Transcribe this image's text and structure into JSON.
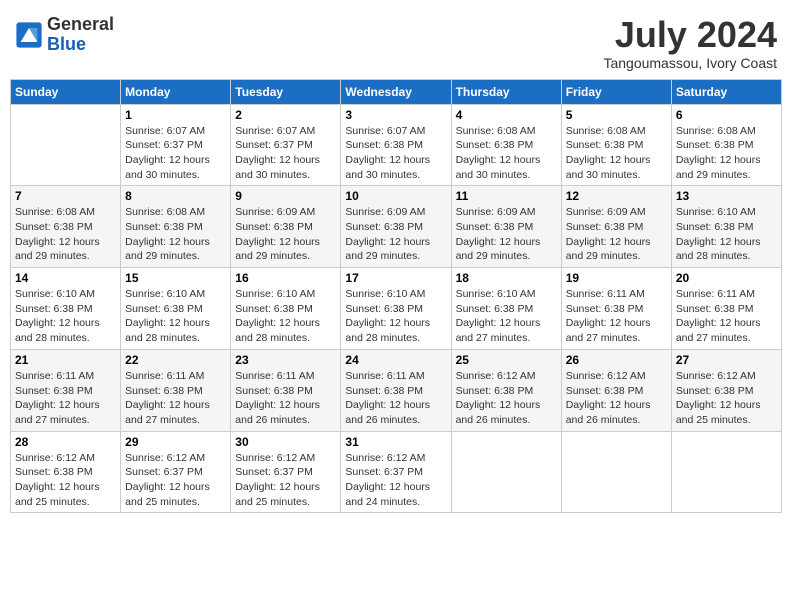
{
  "header": {
    "logo_line1": "General",
    "logo_line2": "Blue",
    "month_year": "July 2024",
    "location": "Tangoumassou, Ivory Coast"
  },
  "days_of_week": [
    "Sunday",
    "Monday",
    "Tuesday",
    "Wednesday",
    "Thursday",
    "Friday",
    "Saturday"
  ],
  "weeks": [
    [
      {
        "day": "",
        "info": ""
      },
      {
        "day": "1",
        "info": "Sunrise: 6:07 AM\nSunset: 6:37 PM\nDaylight: 12 hours\nand 30 minutes."
      },
      {
        "day": "2",
        "info": "Sunrise: 6:07 AM\nSunset: 6:37 PM\nDaylight: 12 hours\nand 30 minutes."
      },
      {
        "day": "3",
        "info": "Sunrise: 6:07 AM\nSunset: 6:38 PM\nDaylight: 12 hours\nand 30 minutes."
      },
      {
        "day": "4",
        "info": "Sunrise: 6:08 AM\nSunset: 6:38 PM\nDaylight: 12 hours\nand 30 minutes."
      },
      {
        "day": "5",
        "info": "Sunrise: 6:08 AM\nSunset: 6:38 PM\nDaylight: 12 hours\nand 30 minutes."
      },
      {
        "day": "6",
        "info": "Sunrise: 6:08 AM\nSunset: 6:38 PM\nDaylight: 12 hours\nand 29 minutes."
      }
    ],
    [
      {
        "day": "7",
        "info": "Sunrise: 6:08 AM\nSunset: 6:38 PM\nDaylight: 12 hours\nand 29 minutes."
      },
      {
        "day": "8",
        "info": "Sunrise: 6:08 AM\nSunset: 6:38 PM\nDaylight: 12 hours\nand 29 minutes."
      },
      {
        "day": "9",
        "info": "Sunrise: 6:09 AM\nSunset: 6:38 PM\nDaylight: 12 hours\nand 29 minutes."
      },
      {
        "day": "10",
        "info": "Sunrise: 6:09 AM\nSunset: 6:38 PM\nDaylight: 12 hours\nand 29 minutes."
      },
      {
        "day": "11",
        "info": "Sunrise: 6:09 AM\nSunset: 6:38 PM\nDaylight: 12 hours\nand 29 minutes."
      },
      {
        "day": "12",
        "info": "Sunrise: 6:09 AM\nSunset: 6:38 PM\nDaylight: 12 hours\nand 29 minutes."
      },
      {
        "day": "13",
        "info": "Sunrise: 6:10 AM\nSunset: 6:38 PM\nDaylight: 12 hours\nand 28 minutes."
      }
    ],
    [
      {
        "day": "14",
        "info": "Sunrise: 6:10 AM\nSunset: 6:38 PM\nDaylight: 12 hours\nand 28 minutes."
      },
      {
        "day": "15",
        "info": "Sunrise: 6:10 AM\nSunset: 6:38 PM\nDaylight: 12 hours\nand 28 minutes."
      },
      {
        "day": "16",
        "info": "Sunrise: 6:10 AM\nSunset: 6:38 PM\nDaylight: 12 hours\nand 28 minutes."
      },
      {
        "day": "17",
        "info": "Sunrise: 6:10 AM\nSunset: 6:38 PM\nDaylight: 12 hours\nand 28 minutes."
      },
      {
        "day": "18",
        "info": "Sunrise: 6:10 AM\nSunset: 6:38 PM\nDaylight: 12 hours\nand 27 minutes."
      },
      {
        "day": "19",
        "info": "Sunrise: 6:11 AM\nSunset: 6:38 PM\nDaylight: 12 hours\nand 27 minutes."
      },
      {
        "day": "20",
        "info": "Sunrise: 6:11 AM\nSunset: 6:38 PM\nDaylight: 12 hours\nand 27 minutes."
      }
    ],
    [
      {
        "day": "21",
        "info": "Sunrise: 6:11 AM\nSunset: 6:38 PM\nDaylight: 12 hours\nand 27 minutes."
      },
      {
        "day": "22",
        "info": "Sunrise: 6:11 AM\nSunset: 6:38 PM\nDaylight: 12 hours\nand 27 minutes."
      },
      {
        "day": "23",
        "info": "Sunrise: 6:11 AM\nSunset: 6:38 PM\nDaylight: 12 hours\nand 26 minutes."
      },
      {
        "day": "24",
        "info": "Sunrise: 6:11 AM\nSunset: 6:38 PM\nDaylight: 12 hours\nand 26 minutes."
      },
      {
        "day": "25",
        "info": "Sunrise: 6:12 AM\nSunset: 6:38 PM\nDaylight: 12 hours\nand 26 minutes."
      },
      {
        "day": "26",
        "info": "Sunrise: 6:12 AM\nSunset: 6:38 PM\nDaylight: 12 hours\nand 26 minutes."
      },
      {
        "day": "27",
        "info": "Sunrise: 6:12 AM\nSunset: 6:38 PM\nDaylight: 12 hours\nand 25 minutes."
      }
    ],
    [
      {
        "day": "28",
        "info": "Sunrise: 6:12 AM\nSunset: 6:38 PM\nDaylight: 12 hours\nand 25 minutes."
      },
      {
        "day": "29",
        "info": "Sunrise: 6:12 AM\nSunset: 6:37 PM\nDaylight: 12 hours\nand 25 minutes."
      },
      {
        "day": "30",
        "info": "Sunrise: 6:12 AM\nSunset: 6:37 PM\nDaylight: 12 hours\nand 25 minutes."
      },
      {
        "day": "31",
        "info": "Sunrise: 6:12 AM\nSunset: 6:37 PM\nDaylight: 12 hours\nand 24 minutes."
      },
      {
        "day": "",
        "info": ""
      },
      {
        "day": "",
        "info": ""
      },
      {
        "day": "",
        "info": ""
      }
    ]
  ]
}
